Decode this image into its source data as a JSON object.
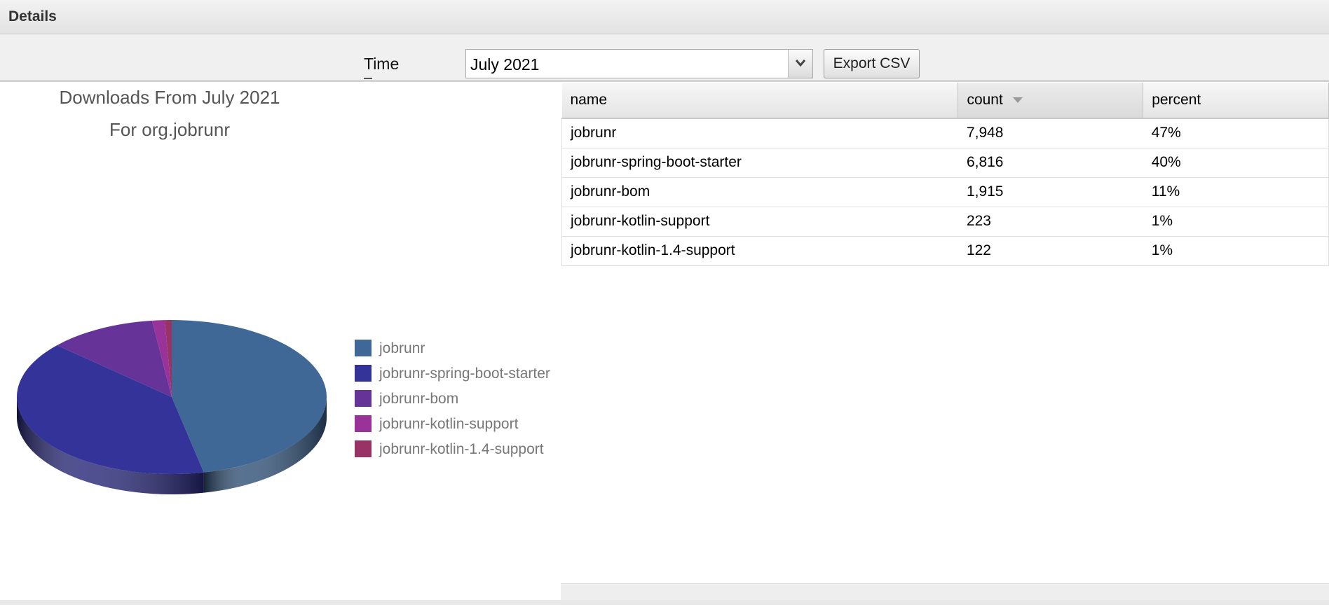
{
  "header": {
    "title": "Details"
  },
  "toolbar": {
    "time_label": "Time",
    "time_select": {
      "value": "July 2021"
    },
    "export_label": "Export CSV"
  },
  "chart_data": {
    "type": "pie",
    "title": "Downloads From July 2021",
    "subtitle": "For org.jobrunr",
    "legend_position": "right",
    "categories": [
      "jobrunr",
      "jobrunr-spring-boot-starter",
      "jobrunr-bom",
      "jobrunr-kotlin-support",
      "jobrunr-kotlin-1.4-support"
    ],
    "values": [
      7948,
      6816,
      1915,
      223,
      122
    ],
    "colors": [
      "#3f6897",
      "#333399",
      "#663399",
      "#993399",
      "#993366"
    ]
  },
  "grid": {
    "columns": [
      {
        "label": "name",
        "sorted": false
      },
      {
        "label": "count",
        "sorted": true,
        "sort_direction": "descending"
      },
      {
        "label": "percent",
        "sorted": false
      }
    ],
    "rows": [
      {
        "name": "jobrunr",
        "count": "7,948",
        "percent": "47%"
      },
      {
        "name": "jobrunr-spring-boot-starter",
        "count": "6,816",
        "percent": "40%"
      },
      {
        "name": "jobrunr-bom",
        "count": "1,915",
        "percent": "11%"
      },
      {
        "name": "jobrunr-kotlin-support",
        "count": "223",
        "percent": "1%"
      },
      {
        "name": "jobrunr-kotlin-1.4-support",
        "count": "122",
        "percent": "1%"
      }
    ]
  },
  "icons": {
    "dropdown": "chevron-down-icon",
    "sort": "sort-descending-icon"
  }
}
